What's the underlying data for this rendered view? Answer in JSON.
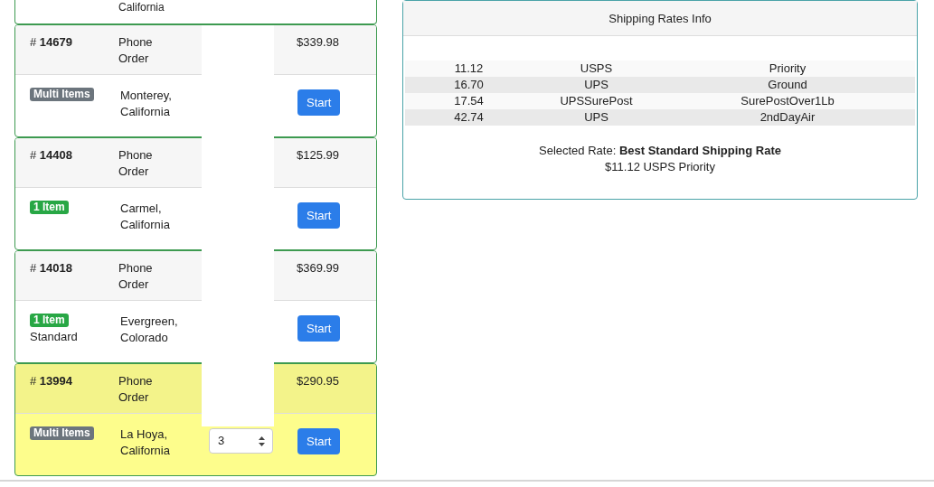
{
  "orders_partial": {
    "location": "California"
  },
  "orders": [
    {
      "number": "# **14679**",
      "source": "Phone Order",
      "total": "$339.98",
      "badge": {
        "label": "Multi Items",
        "kind": "multi"
      },
      "location": "Monterey, California",
      "button": "Start",
      "highlighted": false
    },
    {
      "number": "# **14408**",
      "source": "Phone Order",
      "total": "$125.99",
      "badge": {
        "label": "1 Item",
        "kind": "single"
      },
      "location": "Carmel, California",
      "button": "Start",
      "highlighted": false
    },
    {
      "number": "# **14018**",
      "source": "Phone Order",
      "total": "$369.99",
      "badge": {
        "label": "1 Item",
        "kind": "single"
      },
      "note": "Standard",
      "location": "Evergreen, Colorado",
      "button": "Start",
      "highlighted": false
    },
    {
      "number": "# **13994**",
      "source": "Phone Order",
      "total": "$290.95",
      "badge": {
        "label": "Multi Items",
        "kind": "multi"
      },
      "location": "La Hoya, California",
      "quantity": "3",
      "button": "Start",
      "highlighted": true
    }
  ],
  "shipping_panel": {
    "title": "Shipping Rates Info",
    "rates": [
      {
        "price": "11.12",
        "carrier": "USPS",
        "service": "Priority"
      },
      {
        "price": "16.70",
        "carrier": "UPS",
        "service": "Ground"
      },
      {
        "price": "17.54",
        "carrier": "UPSSurePost",
        "service": "SurePostOver1Lb"
      },
      {
        "price": "42.74",
        "carrier": "UPS",
        "service": "2ndDayAir"
      }
    ],
    "selected_label": "Selected Rate: **Best Standard Shipping Rate**",
    "selected_value": "$11.12 USPS Priority"
  }
}
